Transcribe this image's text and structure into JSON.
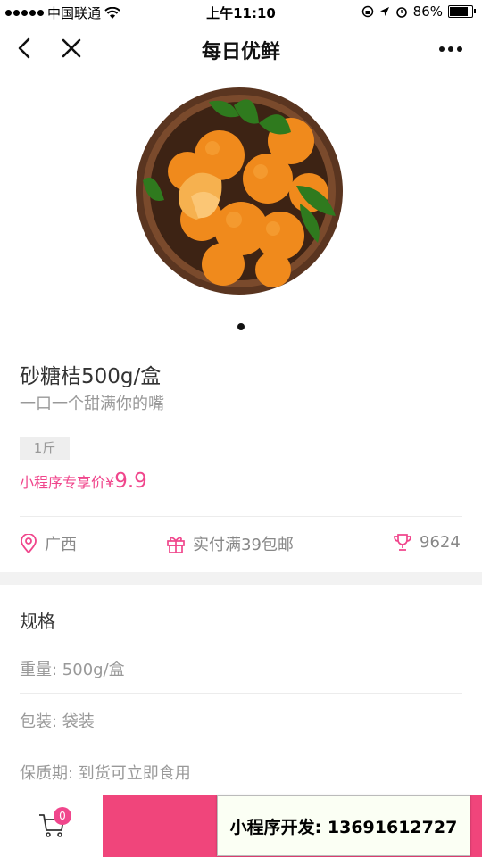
{
  "status_bar": {
    "carrier": "中国联通",
    "time": "上午11:10",
    "battery": "86%",
    "battery_level": 0.86
  },
  "nav": {
    "title": "每日优鲜"
  },
  "product": {
    "name": "砂糖桔500g/盒",
    "subtitle": "一口一个甜满你的嘴",
    "spec_tag": "1斤",
    "price_label": "小程序专享价¥",
    "price_value": "9.9",
    "origin": "广西",
    "shipping": "实付满39包邮",
    "sales": "9624"
  },
  "specs": {
    "title": "规格",
    "weight": "重量: 500g/盒",
    "packaging": "包装: 袋装",
    "shelf_life": "保质期: 到货可立即食用"
  },
  "bottom_bar": {
    "cart_count": "0",
    "contact_banner": "小程序开发: 13691612727"
  },
  "colors": {
    "accent": "#f0468c",
    "buy_button": "#f0457b"
  }
}
